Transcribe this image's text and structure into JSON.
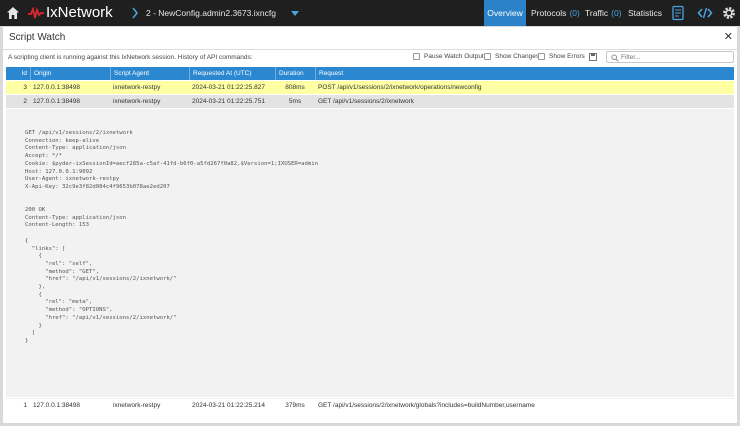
{
  "app": {
    "name": "IxNetwork",
    "config_name": "2 - NewConfig.admin2.3673.ixncfg"
  },
  "nav": [
    {
      "label": "Overview",
      "count": "",
      "active": true
    },
    {
      "label": "Protocols",
      "count": "(0)",
      "active": false
    },
    {
      "label": "Traffic",
      "count": "(0)",
      "active": false
    },
    {
      "label": "Statistics",
      "count": "",
      "active": false
    }
  ],
  "dialog": {
    "title": "Script Watch",
    "info": "A scripting client is running against this IxNetwork session. History of API commands:",
    "options": {
      "pause": "Pause Watch Output",
      "changes": "Show Changes",
      "errors": "Show Errors"
    },
    "filter_placeholder": "Filter..."
  },
  "table": {
    "headers": [
      "Id",
      "Origin",
      "Script Agent",
      "Requested At (UTC)",
      "Duration",
      "Request"
    ],
    "rows": [
      [
        "3",
        "127.0.0.1:38498",
        "ixnetwork-restpy",
        "2024-03-21 01:22:25.827",
        "808ms",
        "POST /api/v1/sessions/2/ixnetwork/operations/newconfig"
      ],
      [
        "2",
        "127.0.0.1:38498",
        "ixnetwork-restpy",
        "2024-03-21 01:22:25.751",
        "5ms",
        "GET /api/v1/sessions/2/ixnetwork"
      ],
      [
        "1",
        "127.0.0.1:38498",
        "ixnetwork-restpy",
        "2024-03-21 01:22:25.214",
        "379ms",
        "GET /api/v1/sessions/2/ixnetwork/globals?includes=buildNumber,username"
      ]
    ]
  },
  "detail": "GET /api/v1/sessions/2/ixnetwork\nConnection: keep-alive\nContent-Type: application/json\nAccept: */*\nCookie: $pyder-ixSessionId=aecf285a-c5af-41fd-b6f0-a5fd267f0a82,$Version=1;IXUSER=admin\nHost: 127.0.0.1:9092\nUser-Agent: ixnetwork-restpy\nX-Api-Key: 32c9e3f82d084c4f9653b078ae2ed207\n\n\n200 OK\nContent-Type: application/json\nContent-Length: 153\n\n{\n  \"links\": [\n    {\n      \"rel\": \"self\",\n      \"method\": \"GET\",\n      \"href\": \"/api/v1/sessions/2/ixnetwork/\"\n    },\n    {\n      \"rel\": \"meta\",\n      \"method\": \"OPTIONS\",\n      \"href\": \"/api/v1/sessions/2/ixnetwork/\"\n    }\n  ]\n}",
  "colors": {
    "accent": "#2b87cf",
    "selected_row": "#ffffa3",
    "topbar": "#1f1f1f"
  }
}
